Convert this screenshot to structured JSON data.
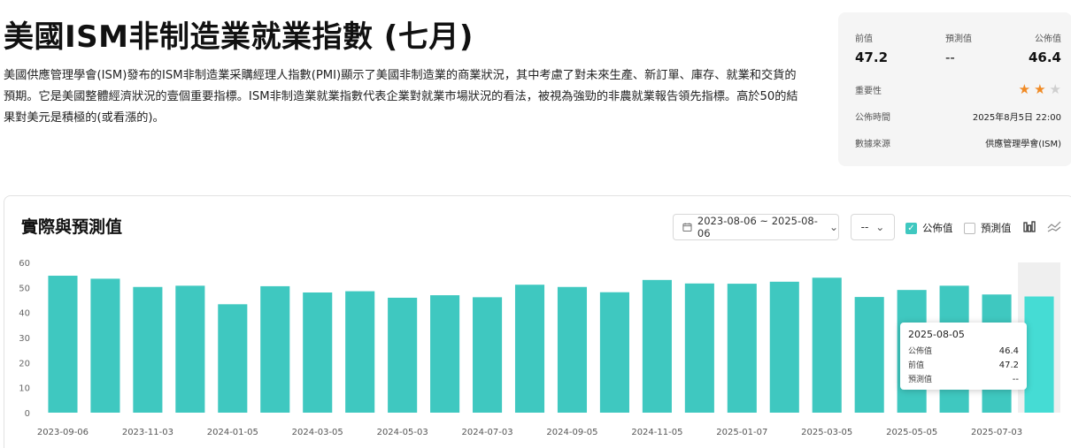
{
  "page": {
    "title": "美國ISM非制造業就業指數 (七月)",
    "description": "美國供應管理學會(ISM)發布的ISM非制造業采購經理人指數(PMI)顯示了美國非制造業的商業狀況，其中考慮了對未來生產、新訂單、庫存、就業和交貨的預期。它是美國整體經濟狀況的壹個重要指標。ISM非制造業就業指數代表企業對就業市場狀況的看法，被視為強勁的非農就業報告領先指標。高於50的結果對美元是積極的(或看漲的)。"
  },
  "info": {
    "prev_label": "前值",
    "prev_value": "47.2",
    "forecast_label": "預測值",
    "forecast_value": "--",
    "actual_label": "公佈值",
    "actual_value": "46.4",
    "importance_label": "重要性",
    "importance_stars": 2,
    "importance_max": 3,
    "time_label": "公佈時間",
    "time_value": "2025年8月5日 22:00",
    "source_label": "數據來源",
    "source_value": "供應管理學會(ISM)"
  },
  "controls": {
    "date_range": "2023-08-06 ~ 2025-08-06",
    "period": "--",
    "actual_toggle": "公佈值",
    "actual_checked": true,
    "forecast_toggle": "預測值",
    "forecast_checked": false
  },
  "tooltip": {
    "date": "2025-08-05",
    "actual_label": "公佈值",
    "actual_value": "46.4",
    "prev_label": "前值",
    "prev_value": "47.2",
    "forecast_label": "預測值",
    "forecast_value": "--"
  },
  "colors": {
    "bar": "#3fc8c0",
    "bar_highlight": "#45dcd4",
    "star": "#f08a24"
  },
  "chart_data": {
    "type": "bar",
    "title": "實際與預測值",
    "ylim": [
      0,
      60
    ],
    "yticks": [
      0,
      10,
      20,
      30,
      40,
      50,
      60
    ],
    "grid": false,
    "highlight_index": 23,
    "x_tick_labels": [
      "2023-09-06",
      "2023-11-03",
      "2024-01-05",
      "2024-03-05",
      "2024-05-03",
      "2024-07-03",
      "2024-09-05",
      "2024-11-05",
      "2025-01-07",
      "2025-03-05",
      "2025-05-05",
      "2025-07-03"
    ],
    "series": [
      {
        "values": [
          54.7,
          53.5,
          50.2,
          50.7,
          43.3,
          50.5,
          48.0,
          48.5,
          45.9,
          46.9,
          46.1,
          51.1,
          50.2,
          48.1,
          53.0,
          51.6,
          51.5,
          52.3,
          53.9,
          46.2,
          49.0,
          50.7,
          47.2,
          46.4
        ]
      }
    ]
  }
}
